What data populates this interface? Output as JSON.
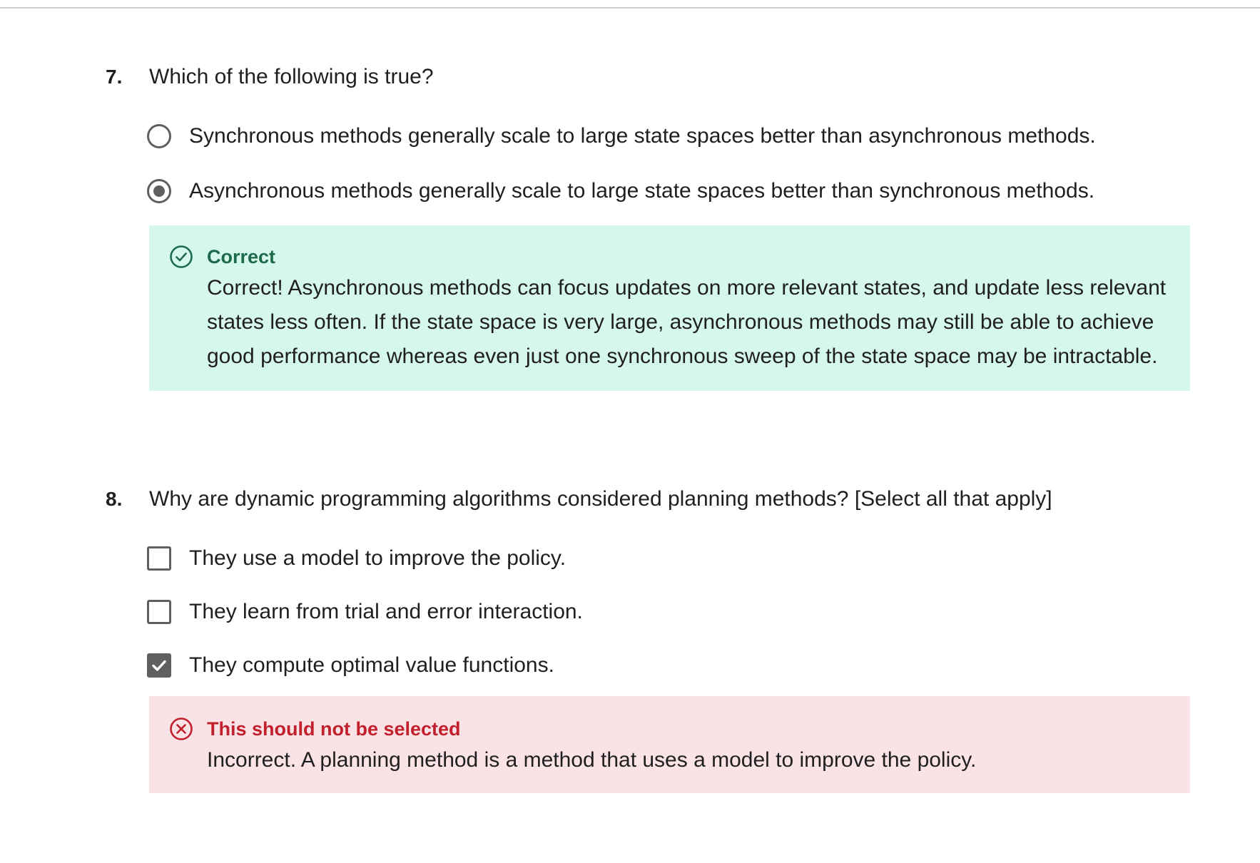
{
  "questions": [
    {
      "number": "7.",
      "prompt": "Which of the following is true?",
      "options": [
        {
          "label": "Synchronous methods generally scale to large state spaces better than asynchronous methods.",
          "selected": false
        },
        {
          "label": "Asynchronous methods generally scale to large state spaces better than synchronous methods.",
          "selected": true
        }
      ],
      "feedback": {
        "status": "correct",
        "title": "Correct",
        "text": "Correct! Asynchronous methods can focus updates on more relevant states, and update less relevant states less often. If the state space is very large, asynchronous methods may still be able to achieve good performance whereas even just one synchronous sweep of the state space may be intractable.",
        "icon": "check-circle-icon",
        "color": "#1e6b4c",
        "background": "#d5f7ec"
      }
    },
    {
      "number": "8.",
      "prompt": "Why are dynamic programming algorithms considered planning methods? [Select all that apply]",
      "options": [
        {
          "label": "They use a model to improve the policy.",
          "checked": false
        },
        {
          "label": "They learn from trial and error interaction.",
          "checked": false
        },
        {
          "label": "They compute optimal value functions.",
          "checked": true
        }
      ],
      "feedback": {
        "status": "incorrect",
        "title": "This should not be selected",
        "text": "Incorrect. A planning method is a method that uses a model to improve the policy.",
        "icon": "x-circle-icon",
        "color": "#c3202e",
        "background": "#f9e3e6"
      }
    }
  ]
}
